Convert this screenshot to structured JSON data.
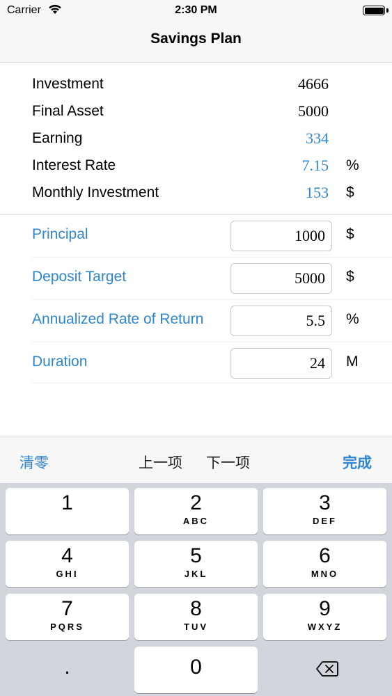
{
  "status_bar": {
    "carrier": "Carrier",
    "time": "2:30 PM"
  },
  "nav": {
    "title": "Savings Plan"
  },
  "results": [
    {
      "label": "Investment",
      "value": "4666",
      "unit": "",
      "highlight": false
    },
    {
      "label": "Final Asset",
      "value": "5000",
      "unit": "",
      "highlight": false
    },
    {
      "label": "Earning",
      "value": "334",
      "unit": "",
      "highlight": true
    },
    {
      "label": "Interest Rate",
      "value": "7.15",
      "unit": "%",
      "highlight": true
    },
    {
      "label": "Monthly Investment",
      "value": "153",
      "unit": "$",
      "highlight": true
    }
  ],
  "inputs": [
    {
      "label": "Principal",
      "value": "1000",
      "unit": "$"
    },
    {
      "label": "Deposit Target",
      "value": "5000",
      "unit": "$"
    },
    {
      "label": "Annualized Rate of Return",
      "value": "5.5",
      "unit": "%"
    },
    {
      "label": "Duration",
      "value": "24",
      "unit": "M"
    }
  ],
  "accessory": {
    "clear": "清零",
    "prev": "上一项",
    "next": "下一项",
    "done": "完成"
  },
  "keypad": {
    "keys": [
      {
        "num": "1",
        "letters": ""
      },
      {
        "num": "2",
        "letters": "ABC"
      },
      {
        "num": "3",
        "letters": "DEF"
      },
      {
        "num": "4",
        "letters": "GHI"
      },
      {
        "num": "5",
        "letters": "JKL"
      },
      {
        "num": "6",
        "letters": "MNO"
      },
      {
        "num": "7",
        "letters": "PQRS"
      },
      {
        "num": "8",
        "letters": "TUV"
      },
      {
        "num": "9",
        "letters": "WXYZ"
      }
    ],
    "dot": ".",
    "zero": "0"
  },
  "colors": {
    "accent": "#2f86d0",
    "keypad_bg": "#d2d5db"
  },
  "icons": [
    "wifi-icon",
    "battery-icon",
    "backspace-icon"
  ]
}
